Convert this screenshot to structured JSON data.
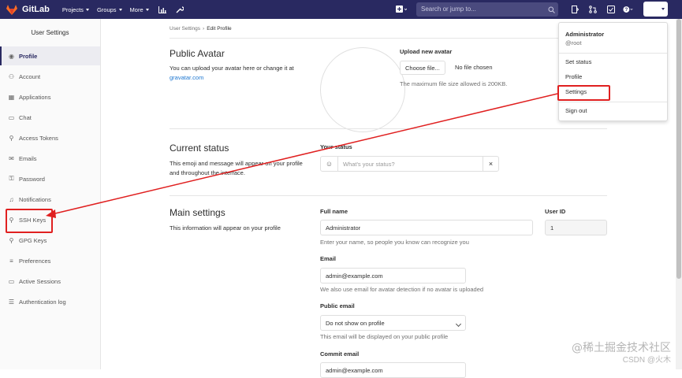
{
  "topbar": {
    "brand": "GitLab",
    "nav": [
      "Projects",
      "Groups",
      "More"
    ],
    "search_placeholder": "Search or jump to..."
  },
  "sidebar": {
    "title": "User Settings",
    "items": [
      {
        "label": "Profile",
        "icon": "profile-icon",
        "active": true
      },
      {
        "label": "Account",
        "icon": "account-icon"
      },
      {
        "label": "Applications",
        "icon": "applications-icon"
      },
      {
        "label": "Chat",
        "icon": "chat-icon"
      },
      {
        "label": "Access Tokens",
        "icon": "key-icon"
      },
      {
        "label": "Emails",
        "icon": "mail-icon"
      },
      {
        "label": "Password",
        "icon": "lock-icon"
      },
      {
        "label": "Notifications",
        "icon": "bell-icon"
      },
      {
        "label": "SSH Keys",
        "icon": "key-icon"
      },
      {
        "label": "GPG Keys",
        "icon": "key-icon"
      },
      {
        "label": "Preferences",
        "icon": "sliders-icon"
      },
      {
        "label": "Active Sessions",
        "icon": "monitor-icon"
      },
      {
        "label": "Authentication log",
        "icon": "list-icon"
      }
    ]
  },
  "breadcrumb": {
    "parent": "User Settings",
    "sep": "›",
    "current": "Edit Profile"
  },
  "avatar_section": {
    "title": "Public Avatar",
    "desc_prefix": "You can upload your avatar here or change it at",
    "desc_link": "gravatar.com",
    "upload_label": "Upload new avatar",
    "choose_button": "Choose file...",
    "no_file": "No file chosen",
    "max_size": "The maximum file size allowed is 200KB."
  },
  "status_section": {
    "title": "Current status",
    "desc": "This emoji and message will appear on your profile and throughout the interface.",
    "field_label": "Your status",
    "placeholder": "What's your status?",
    "clear": "×"
  },
  "main_section": {
    "title": "Main settings",
    "desc": "This information will appear on your profile",
    "full_name_label": "Full name",
    "full_name_value": "Administrator",
    "full_name_help": "Enter your name, so people you know can recognize you",
    "user_id_label": "User ID",
    "user_id_value": "1",
    "email_label": "Email",
    "email_value": "admin@example.com",
    "email_help": "We also use email for avatar detection if no avatar is uploaded",
    "public_email_label": "Public email",
    "public_email_value": "Do not show on profile",
    "public_email_help": "This email will be displayed on your public profile",
    "commit_email_label": "Commit email",
    "commit_email_value": "admin@example.com"
  },
  "user_menu": {
    "name": "Administrator",
    "username": "@root",
    "items": [
      "Set status",
      "Profile",
      "Settings",
      "Sign out"
    ]
  },
  "watermark": {
    "line1": "@稀土掘金技术社区",
    "line2": "CSDN @火木"
  },
  "colors": {
    "header": "#292961",
    "annotation": "#e02020",
    "link": "#1f78d1"
  }
}
